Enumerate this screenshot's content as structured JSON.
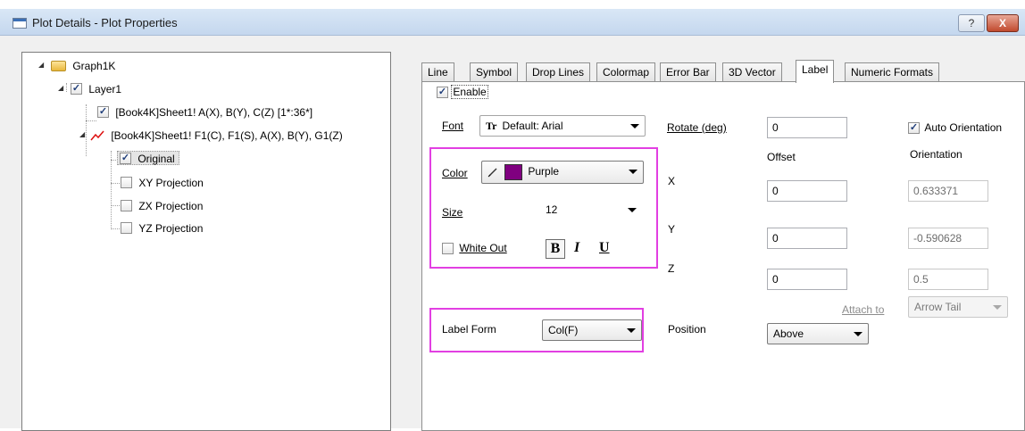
{
  "window": {
    "title": "Plot Details - Plot Properties",
    "help_label": "?",
    "close_label": "X"
  },
  "tree": {
    "root": {
      "label": "Graph1K"
    },
    "layer": {
      "label": "Layer1",
      "checked": true
    },
    "plot1": {
      "label": "[Book4K]Sheet1! A(X), B(Y), C(Z) [1*:36*]",
      "checked": true
    },
    "plot2": {
      "label": "[Book4K]Sheet1! F1(C), F1(S), A(X), B(Y), G1(Z)"
    },
    "children": [
      {
        "label": "Original",
        "checked": true,
        "selected": true
      },
      {
        "label": "XY Projection",
        "checked": false
      },
      {
        "label": "ZX Projection",
        "checked": false
      },
      {
        "label": "YZ Projection",
        "checked": false
      }
    ]
  },
  "tabs": [
    "Line",
    "Symbol",
    "Drop Lines",
    "Colormap",
    "Error Bar",
    "3D Vector",
    "Label",
    "Numeric Formats"
  ],
  "active_tab": "Label",
  "label_tab": {
    "enable": {
      "label": "Enable",
      "checked": true
    },
    "font": {
      "label": "Font",
      "value": "Default: Arial",
      "icon_text": "Tr"
    },
    "color": {
      "label": "Color",
      "value": "Purple",
      "swatch_color": "#800080"
    },
    "size": {
      "label": "Size",
      "value": "12"
    },
    "white_out": {
      "label": "White Out",
      "checked": false
    },
    "style_buttons": {
      "bold": "B",
      "italic": "I",
      "underline": "U"
    },
    "rotate": {
      "label": "Rotate (deg)",
      "value": "0"
    },
    "offset_header": "Offset",
    "orientation_header": "Orientation",
    "auto_orientation": {
      "label": "Auto Orientation",
      "checked": true
    },
    "x": {
      "label": "X",
      "offset": "0",
      "orientation": "0.633371"
    },
    "y": {
      "label": "Y",
      "offset": "0",
      "orientation": "-0.590628"
    },
    "z": {
      "label": "Z",
      "offset": "0",
      "orientation": "0.5"
    },
    "attach_to": {
      "label": "Attach to",
      "value": "Arrow Tail"
    },
    "label_form": {
      "label": "Label Form",
      "value": "Col(F)"
    },
    "position": {
      "label": "Position",
      "value": "Above"
    }
  },
  "colors": {
    "highlight": "#e23fe2",
    "purple": "#800080",
    "checkmark": "#1f3d79"
  }
}
